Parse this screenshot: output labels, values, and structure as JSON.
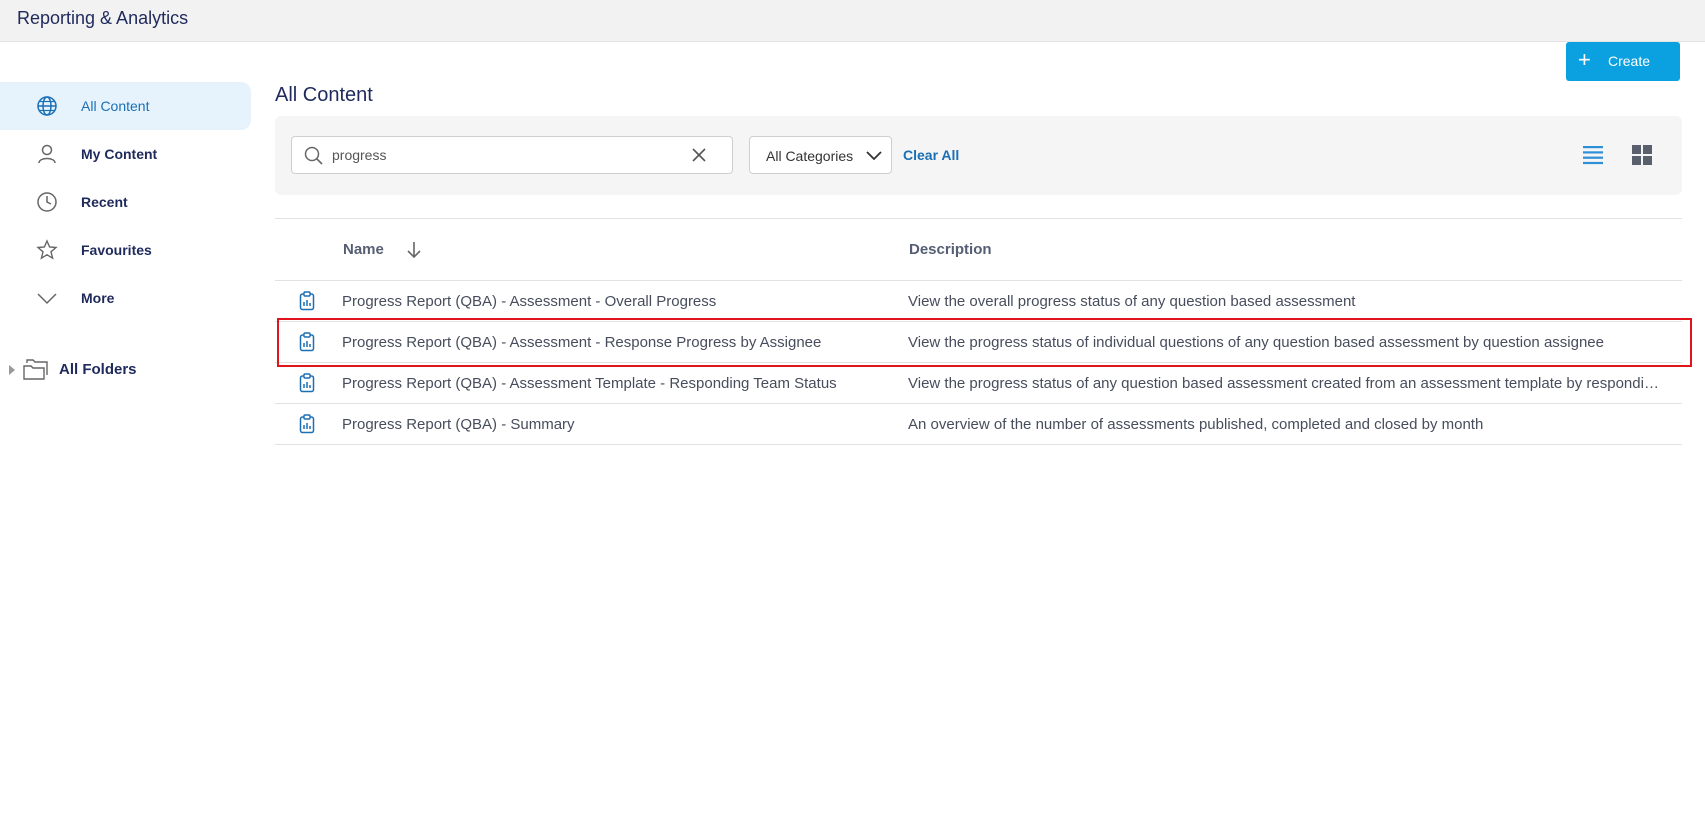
{
  "app": {
    "title": "Reporting & Analytics"
  },
  "sidebar": {
    "items": [
      {
        "label": "All Content",
        "icon": "globe-icon",
        "active": true
      },
      {
        "label": "My Content",
        "icon": "user-icon",
        "active": false
      },
      {
        "label": "Recent",
        "icon": "clock-icon",
        "active": false
      },
      {
        "label": "Favourites",
        "icon": "star-icon",
        "active": false
      },
      {
        "label": "More",
        "icon": "chevron-down-icon",
        "active": false
      }
    ],
    "folders_label": "All Folders"
  },
  "header": {
    "create_label": "Create"
  },
  "main": {
    "title": "All Content",
    "search": {
      "value": "progress",
      "placeholder": ""
    },
    "category_select": "All Categories",
    "clear_all": "Clear All",
    "columns": {
      "name": "Name",
      "description": "Description"
    },
    "rows": [
      {
        "name": "Progress Report (QBA) - Assessment - Overall Progress",
        "description": "View the overall progress status of any question based assessment"
      },
      {
        "name": "Progress Report (QBA) - Assessment - Response Progress by Assignee",
        "description": "View the progress status of individual questions of any question based assessment by question assignee"
      },
      {
        "name": "Progress Report (QBA) - Assessment Template - Responding Team Status",
        "description": "View the progress status of any question based assessment created from an assessment template by responding team"
      },
      {
        "name": "Progress Report (QBA) - Summary",
        "description": "An overview of the number of assessments published, completed and closed by month"
      }
    ]
  },
  "colors": {
    "accent": "#0ba1e0",
    "link": "#1b6fb5",
    "highlight": "#e0141c",
    "active_bg": "#e6f3fd"
  }
}
